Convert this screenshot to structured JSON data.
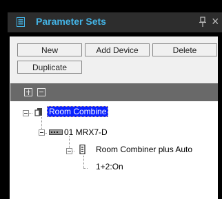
{
  "panel": {
    "title": "Parameter Sets",
    "pin_glyph": "pin-icon",
    "close_glyph": "×"
  },
  "buttons": {
    "new": "New",
    "add_device": "Add Device",
    "delete": "Delete",
    "duplicate": "Duplicate"
  },
  "toolbar": {
    "expand_all": "expand-all-icon",
    "collapse_all": "collapse-all-icon"
  },
  "tree": {
    "root": "Room Combine",
    "device": "01 MRX7-D",
    "component": "Room Combiner plus Auto",
    "setting": "1+2:On"
  },
  "colors": {
    "title": "#44b4e6",
    "selection": "#0a22ff",
    "toolbar": "#696969"
  }
}
